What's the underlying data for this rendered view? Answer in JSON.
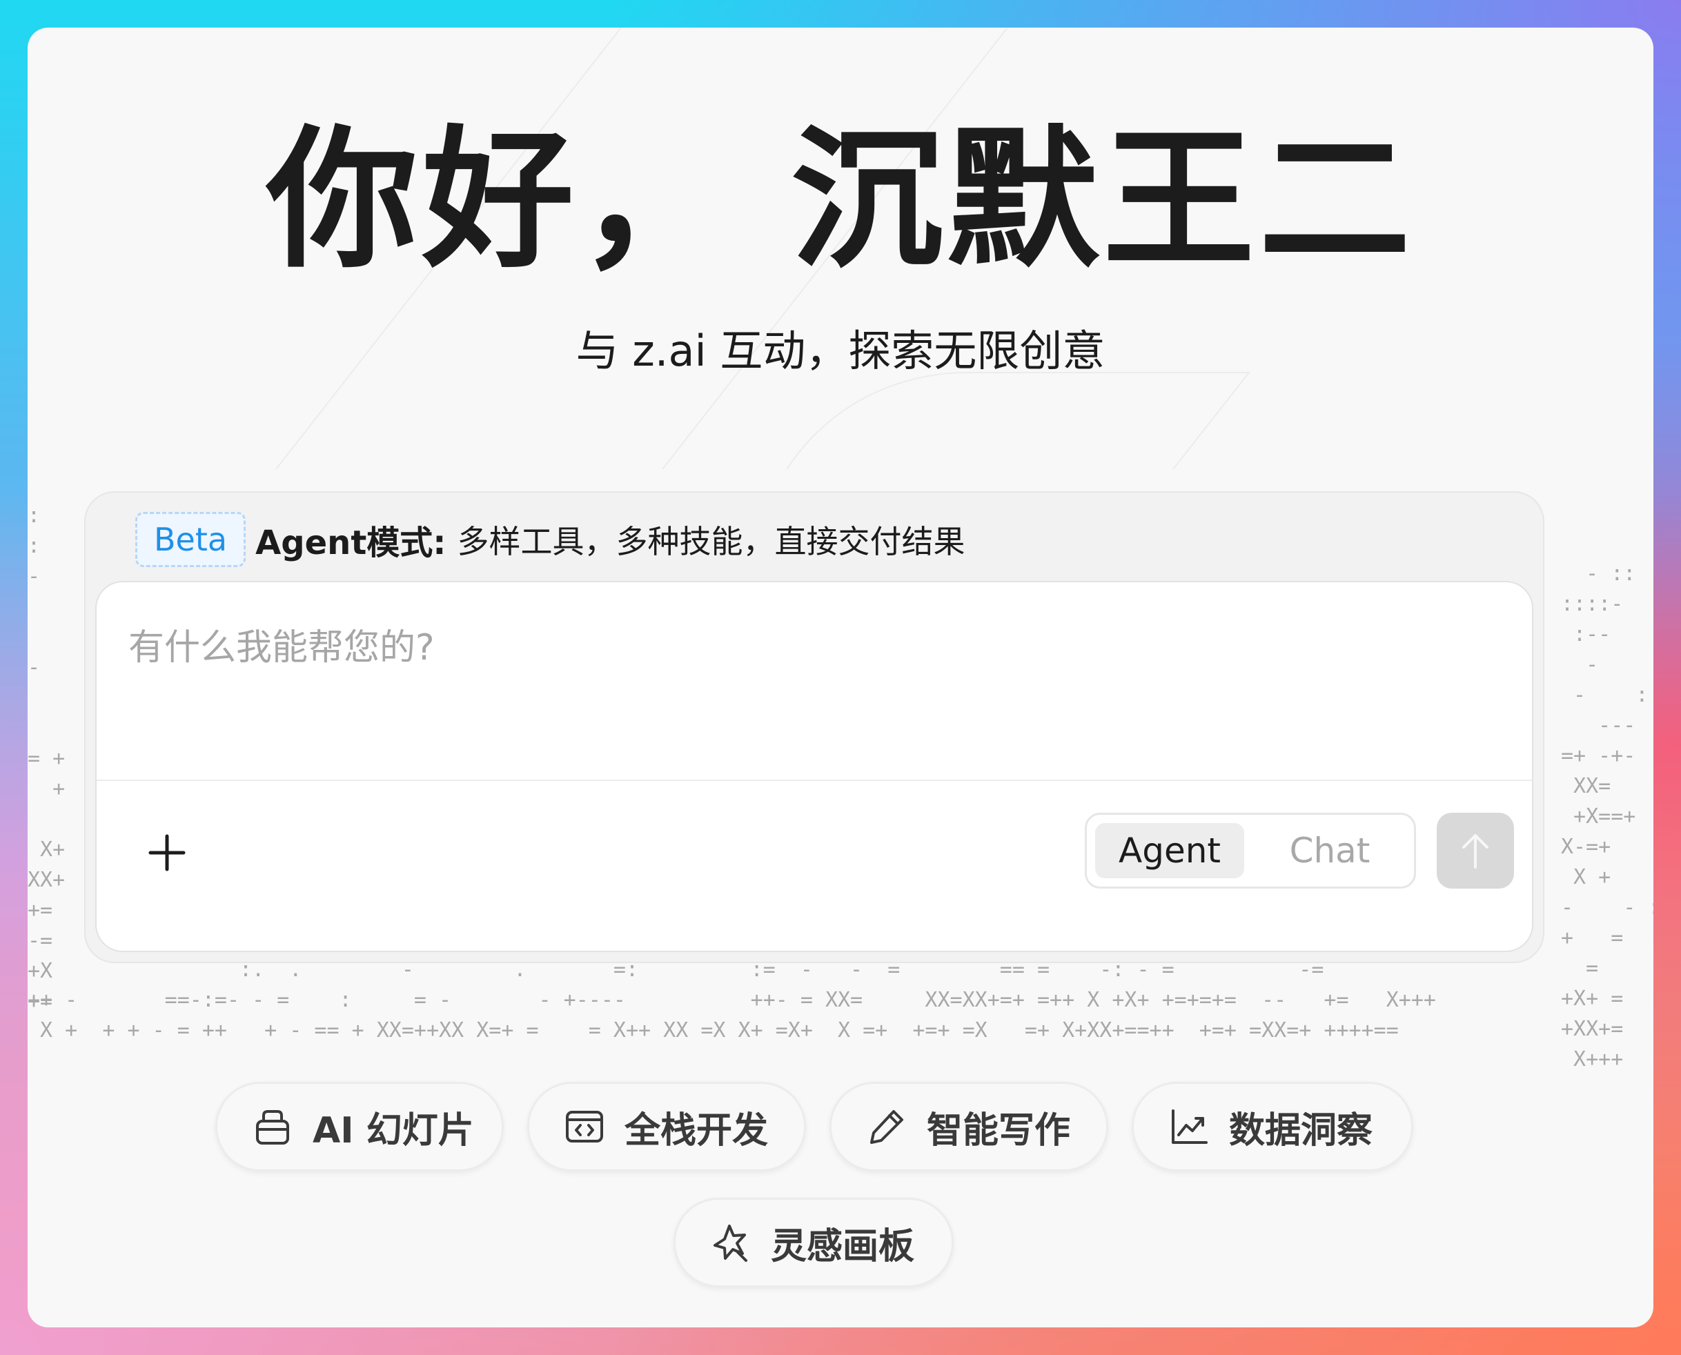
{
  "hero": {
    "greeting": "你好， 沉默王二",
    "subtitle": "与 z.ai 互动，探索无限创意"
  },
  "agent_banner": {
    "badge": "Beta",
    "title": "Agent模式:",
    "description": "多样工具，多种技能，直接交付结果"
  },
  "composer": {
    "placeholder": "有什么我能帮您的?",
    "value": "",
    "modes": [
      {
        "label": "Agent",
        "selected": true
      },
      {
        "label": "Chat",
        "selected": false
      }
    ]
  },
  "quick_actions": [
    {
      "label": "AI 幻灯片",
      "icon": "presentation-icon"
    },
    {
      "label": "全栈开发",
      "icon": "code-window-icon"
    },
    {
      "label": "智能写作",
      "icon": "pen-icon"
    },
    {
      "label": "数据洞察",
      "icon": "chart-trend-icon"
    },
    {
      "label": "灵感画板",
      "icon": "sparkle-star-icon"
    }
  ],
  "decoration": {
    "ascii_left": ":\n:\n-\n\n\n-\n\n\n= +\n  +\n\n X+\nXX+\n+=\n-=\n+X\n+=",
    "ascii_right": "  - ::\n::::-\n :--\n  -\n -    :\n   ---\n=+ -+-\n XX=\n +X==+\nX-=+\n X +\n-    - :\n+   =\n  =\n+X+ =\n+XX+=\n X+++",
    "ascii_bottom": "                 :.  .        -        .       =:         :=  -   -  =        == =    -: - =          -=\n++ -       ==-:=- - =    :     = -       - +----          ++- = XX=     XX=XX+=+ =++ X +X+ +=+=+=  --   +=   X+++\n X +  + + - = ++   + - == + XX=++XX X=+ =    = X++ XX =X X+ =X+  X =+  +=+ =X   =+ X+XX+==++  +=+ =XX=+ ++++==",
    "accent_color": "#1e90e8",
    "send_button_color": "#d9d9d9"
  }
}
